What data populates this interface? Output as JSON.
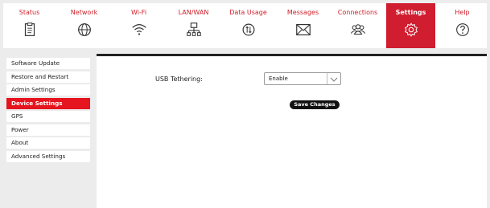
{
  "nav": {
    "tabs": [
      {
        "label": "Status",
        "icon": "clipboard-icon"
      },
      {
        "label": "Network",
        "icon": "globe-icon"
      },
      {
        "label": "Wi-Fi",
        "icon": "wifi-icon"
      },
      {
        "label": "LAN/WAN",
        "icon": "lan-icon"
      },
      {
        "label": "Data Usage",
        "icon": "data-usage-icon"
      },
      {
        "label": "Messages",
        "icon": "envelope-icon"
      },
      {
        "label": "Connections",
        "icon": "users-icon"
      },
      {
        "label": "Settings",
        "icon": "gear-icon",
        "active": true
      },
      {
        "label": "Help",
        "icon": "help-icon"
      }
    ]
  },
  "sidebar": {
    "items": [
      {
        "label": "Software Update"
      },
      {
        "label": "Restore and Restart"
      },
      {
        "label": "Admin Settings"
      },
      {
        "label": "Device Settings",
        "active": true
      },
      {
        "label": "GPS"
      },
      {
        "label": "Power"
      },
      {
        "label": "About"
      },
      {
        "label": "Advanced Settings"
      }
    ]
  },
  "main": {
    "usb_tethering_label": "USB Tethering:",
    "usb_tethering_value": "Enable",
    "save_label": "Save Changes"
  },
  "colors": {
    "accent": "#d01d2f",
    "sidebar_active": "#e5141e",
    "tab_label": "#d0202a"
  }
}
